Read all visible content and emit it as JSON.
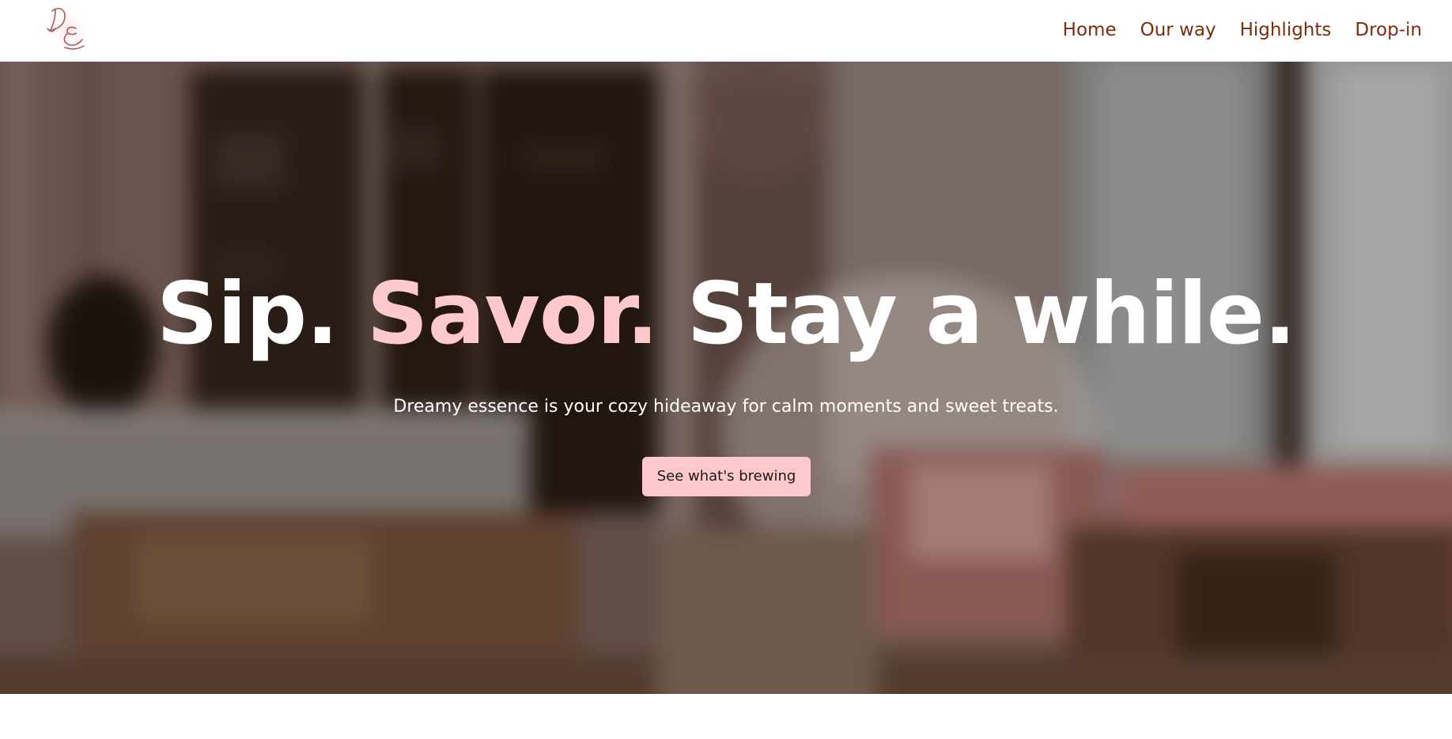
{
  "brand": {
    "logo_monogram": "DE"
  },
  "nav": {
    "items": [
      {
        "label": "Home"
      },
      {
        "label": "Our way"
      },
      {
        "label": "Highlights"
      },
      {
        "label": "Drop-in"
      }
    ]
  },
  "hero": {
    "title_part1": "Sip.",
    "title_part2": "Savor.",
    "title_part3": "Stay a while.",
    "subtitle": "Dreamy essence is your cozy hideaway for calm moments and sweet treats.",
    "cta_label": "See what's brewing"
  },
  "colors": {
    "nav_text": "#7a2e0e",
    "accent_pink": "#ffc9cc",
    "cta_bg": "#ffc8cb",
    "hero_text": "#ffffff"
  }
}
